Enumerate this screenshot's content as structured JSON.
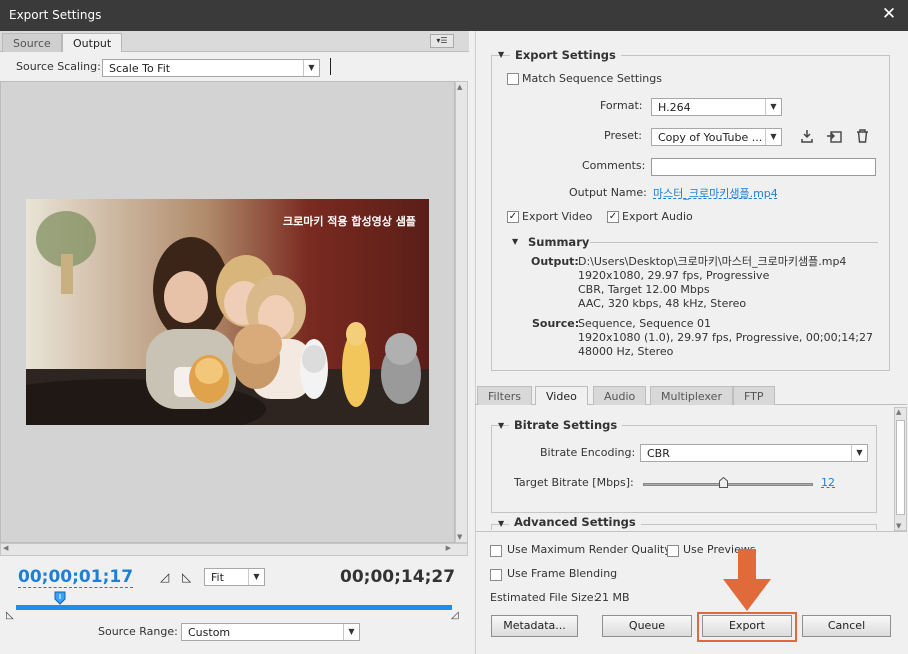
{
  "window": {
    "title": "Export Settings",
    "close_glyph": "✕"
  },
  "left": {
    "tabs": [
      "Source",
      "Output"
    ],
    "panel_menu_glyph": "▾☰",
    "source_scaling_label": "Source Scaling:",
    "source_scaling_value": "Scale To Fit",
    "video_overlay_text": "크로마키 적용 합성영상 샘플",
    "timecode_current": "00;00;01;17",
    "timecode_end": "00;00;14;27",
    "zoom_value": "Fit",
    "playhead_progress": 0.1,
    "source_range_label": "Source Range:",
    "source_range_value": "Custom"
  },
  "export_settings": {
    "section": "Export Settings",
    "match_sequence": "Match Sequence Settings",
    "format_label": "Format:",
    "format_value": "H.264",
    "preset_label": "Preset:",
    "preset_value": "Copy of YouTube ...",
    "comments_label": "Comments:",
    "comments_value": "",
    "output_name_label": "Output Name:",
    "output_name_value": "마스터_크로마키샘플.mp4",
    "export_video": "Export Video",
    "export_audio": "Export Audio",
    "summary": "Summary",
    "output_key": "Output:",
    "output_lines": [
      "D:\\Users\\Desktop\\크로마키\\마스터_크로마키샘플.mp4",
      "1920x1080, 29.97 fps, Progressive",
      "CBR, Target 12.00 Mbps",
      "AAC, 320 kbps, 48 kHz, Stereo"
    ],
    "source_key": "Source:",
    "source_lines": [
      "Sequence, Sequence 01",
      "1920x1080 (1.0), 29.97 fps, Progressive, 00;00;14;27",
      "48000 Hz, Stereo"
    ]
  },
  "tabs": [
    "Filters",
    "Video",
    "Audio",
    "Multiplexer",
    "FTP"
  ],
  "bitrate": {
    "section": "Bitrate Settings",
    "encoding_label": "Bitrate Encoding:",
    "encoding_value": "CBR",
    "target_label": "Target Bitrate [Mbps]:",
    "target_value": "12",
    "slider_fraction": 0.47
  },
  "advanced": {
    "section": "Advanced Settings"
  },
  "options": {
    "max_quality": "Use Maximum Render Quality",
    "use_previews": "Use Previews",
    "frame_blending": "Use Frame Blending",
    "file_size_label": "Estimated File Size:",
    "file_size_value": "21 MB"
  },
  "buttons": {
    "metadata": "Metadata...",
    "queue": "Queue",
    "export": "Export",
    "cancel": "Cancel"
  },
  "colors": {
    "accent": "#1d7fd6",
    "highlight": "#e06a3a"
  }
}
